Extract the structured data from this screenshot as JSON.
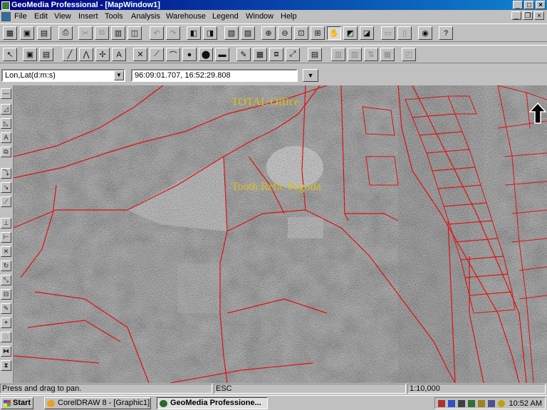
{
  "window": {
    "title": "GeoMedia Professional - [MapWindow1]"
  },
  "menu": [
    "File",
    "Edit",
    "View",
    "Insert",
    "Tools",
    "Analysis",
    "Warehouse",
    "Legend",
    "Window",
    "Help"
  ],
  "coords": {
    "system": "Lon,Lat(d:m:s)",
    "value": "96:09:01.707, 16:52:29.808"
  },
  "map": {
    "labels": {
      "total_office": "TOTAL Office",
      "pagoda": "Tooth Relic Pagoda"
    },
    "parcel_color": "#e01010",
    "label_color": "#d8c020"
  },
  "status": {
    "message": "Press and drag to pan.",
    "key": "ESC",
    "scale": "1:10,000"
  },
  "taskbar": {
    "start": "Start",
    "tasks": [
      "CorelDRAW 8 - [Graphic1]",
      "GeoMedia Professione..."
    ],
    "clock": "10:52 AM"
  }
}
